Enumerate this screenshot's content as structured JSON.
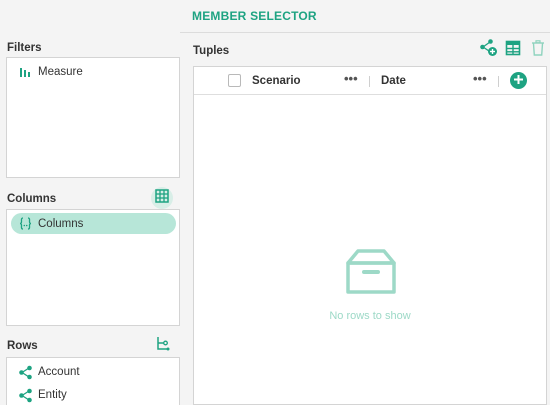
{
  "header": {
    "title": "MEMBER SELECTOR"
  },
  "filters": {
    "label": "Filters",
    "items": [
      {
        "label": "Measure",
        "icon": "measure-bars-icon"
      }
    ]
  },
  "columns": {
    "label": "Columns",
    "action_icon": "grid-table-icon",
    "items": [
      {
        "label": "Columns",
        "icon": "curly-braces-icon",
        "selected": true
      }
    ]
  },
  "rows": {
    "label": "Rows",
    "action_icon": "hierarchy-icon",
    "items": [
      {
        "label": "Account",
        "icon": "share-node-icon"
      },
      {
        "label": "Entity",
        "icon": "share-node-icon"
      }
    ]
  },
  "tuples": {
    "label": "Tuples",
    "toolbar_icons": [
      "add-node-icon",
      "table-list-icon",
      "trash-icon"
    ],
    "grid": {
      "columns": [
        {
          "title": "Scenario",
          "menu": "•••"
        },
        {
          "title": "Date",
          "menu": "•••"
        }
      ],
      "empty_text": "No rows to show"
    }
  },
  "colors": {
    "accent": "#1ea382",
    "selected_bg": "#b7e6d8",
    "empty_icon": "#9dd9c7"
  }
}
